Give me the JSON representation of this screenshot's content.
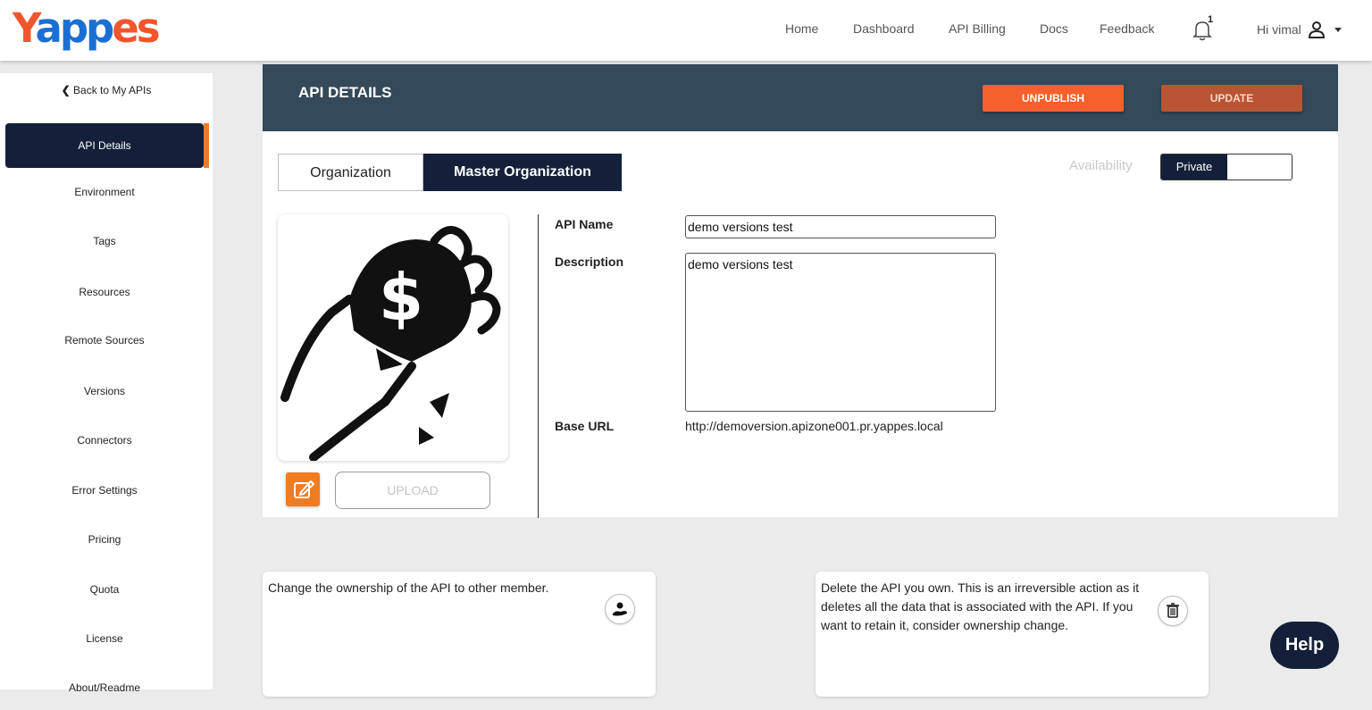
{
  "brand": {
    "logo_part1": "Y",
    "logo_part2": "a",
    "logo_part3": "pp",
    "logo_part4": "es"
  },
  "nav": {
    "items": [
      "Home",
      "Dashboard",
      "API Billing",
      "Docs",
      "Feedback"
    ],
    "notification_count": "1",
    "greeting": "Hi vimal"
  },
  "sidebar": {
    "back_label": "Back to My APIs",
    "items": [
      {
        "label": "API Details",
        "active": true
      },
      {
        "label": "Environment"
      },
      {
        "label": "Tags"
      },
      {
        "label": "Resources"
      },
      {
        "label": "Remote Sources"
      },
      {
        "label": "Versions"
      },
      {
        "label": "Connectors"
      },
      {
        "label": "Error Settings"
      },
      {
        "label": "Pricing"
      },
      {
        "label": "Quota"
      },
      {
        "label": "License"
      },
      {
        "label": "About/Readme"
      }
    ]
  },
  "header": {
    "title": "API DETAILS",
    "unpublish_label": "UNPUBLISH",
    "update_label": "UPDATE"
  },
  "tabs": {
    "organization": "Organization",
    "master": "Master Organization"
  },
  "availability": {
    "label": "Availability",
    "selected": "Private"
  },
  "form": {
    "api_name_label": "API Name",
    "api_name_value": "demo versions test",
    "description_label": "Description",
    "description_value": "demo versions test",
    "base_url_label": "Base URL",
    "base_url_value": "http://demoversion.apizone001.pr.yappes.local"
  },
  "upload_label": "UPLOAD",
  "cards": {
    "ownership_text": "Change the ownership of the API to other member.",
    "delete_text": "Delete the API you own. This is an irreversible action as it deletes all the data that is associated with the API. If you want to retain it, consider ownership change."
  },
  "help_label": "Help",
  "colors": {
    "navy": "#14203a",
    "orange": "#f5602c",
    "header_slate": "#34495a"
  }
}
